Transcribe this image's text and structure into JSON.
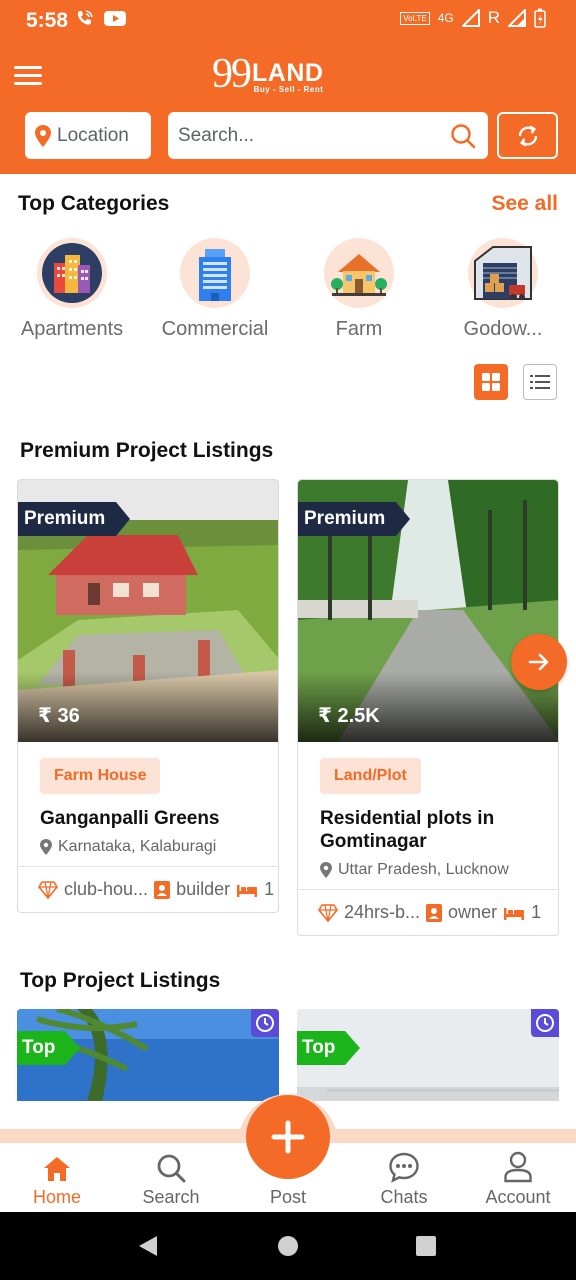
{
  "status_bar": {
    "time": "5:58",
    "volte_label": "VoLTE",
    "network": "4G",
    "roaming": "R"
  },
  "header": {
    "logo_99": "99",
    "logo_land": "LAND",
    "logo_tagline": "Buy - Sell - Rent",
    "location_label": "Location",
    "search_placeholder": "Search..."
  },
  "categories": {
    "title": "Top Categories",
    "see_all": "See all",
    "items": [
      {
        "label": "Apartments"
      },
      {
        "label": "Commercial"
      },
      {
        "label": "Farm"
      },
      {
        "label": "Godow..."
      }
    ]
  },
  "premium": {
    "title": "Premium Project Listings",
    "cards": [
      {
        "badge": "Premium",
        "price": "₹ 36",
        "tag": "Farm House",
        "title": "Ganganpalli Greens",
        "location": "Karnataka, Kalaburagi",
        "amenity": "club-hou...",
        "posted_by": "builder",
        "beds": "1"
      },
      {
        "badge": "Premium",
        "price": "₹ 2.5K",
        "tag": "Land/Plot",
        "title": "Residential plots in Gomtinagar",
        "location": "Uttar Pradesh, Lucknow",
        "amenity": "24hrs-b...",
        "posted_by": "owner",
        "beds": "1"
      }
    ]
  },
  "top_listings": {
    "title": "Top Project Listings",
    "cards": [
      {
        "badge": "Top"
      },
      {
        "badge": "Top"
      }
    ]
  },
  "bottom_nav": {
    "items": [
      {
        "label": "Home",
        "icon": "home-icon",
        "active": true
      },
      {
        "label": "Search",
        "icon": "search-icon"
      },
      {
        "label": "Post",
        "icon": "plus-icon"
      },
      {
        "label": "Chats",
        "icon": "chat-icon"
      },
      {
        "label": "Account",
        "icon": "account-icon"
      }
    ]
  },
  "colors": {
    "brand": "#f36b27",
    "brand_light": "#fde3d6",
    "premium_badge": "#1e2a44",
    "top_badge": "#1bb51b",
    "clock_badge": "#5a4cd8"
  }
}
